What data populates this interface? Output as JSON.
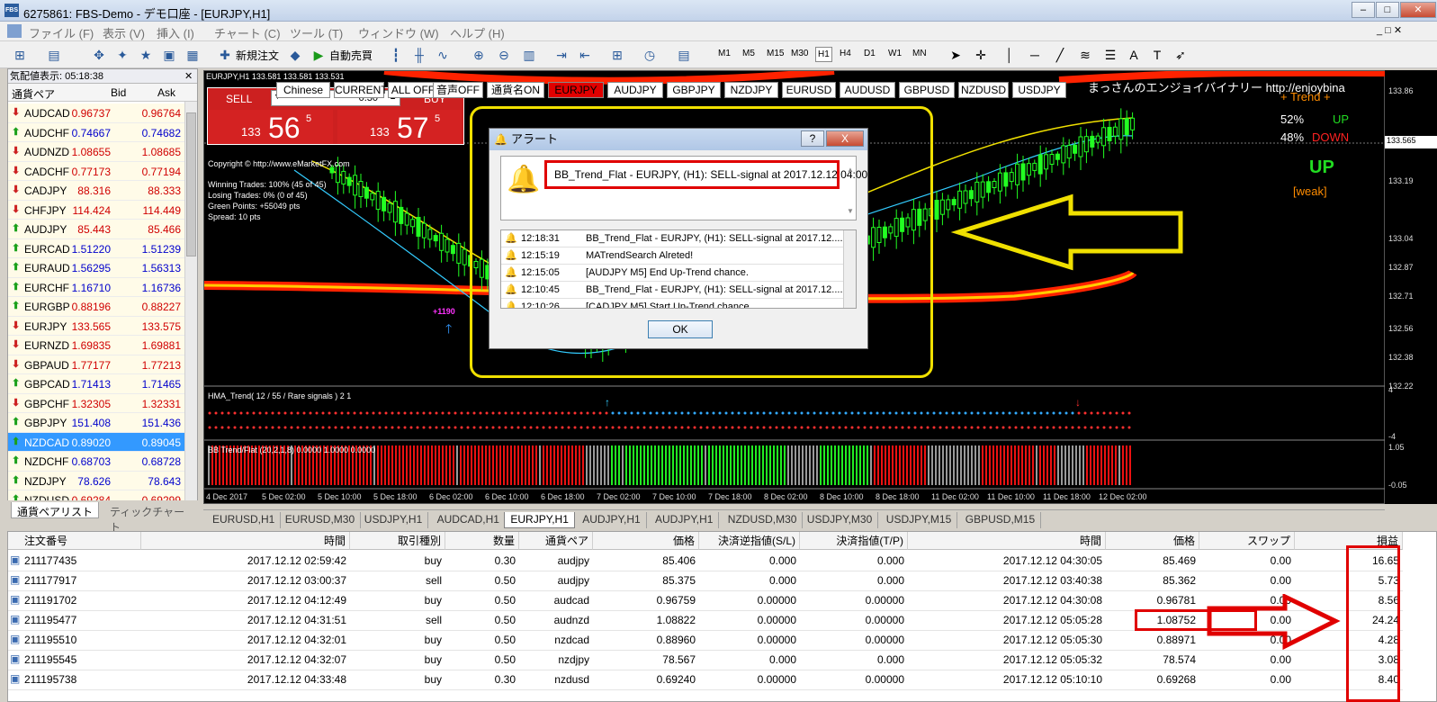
{
  "window": {
    "title": "6275861: FBS-Demo - デモ口座 - [EURJPY,H1]",
    "icon_text": "FBS"
  },
  "menu": [
    "ファイル (F)",
    "表示 (V)",
    "挿入 (I)",
    "チャート (C)",
    "ツール (T)",
    "ウィンドウ (W)",
    "ヘルプ (H)"
  ],
  "toolbar": {
    "new_order": "新規注文",
    "autotrade": "自動売買",
    "timeframes": [
      "M1",
      "M5",
      "M15",
      "M30",
      "H1",
      "H4",
      "D1",
      "W1",
      "MN"
    ],
    "selected_tf": "H1"
  },
  "market_watch": {
    "header": "気配値表示: 05:18:38",
    "columns": [
      "通貨ペア",
      "Bid",
      "Ask"
    ],
    "rows": [
      {
        "symbol": "AUDCAD",
        "bid": "0.96737",
        "ask": "0.96764",
        "dir": "dn"
      },
      {
        "symbol": "AUDCHF",
        "bid": "0.74667",
        "ask": "0.74682",
        "dir": "up"
      },
      {
        "symbol": "AUDNZD",
        "bid": "1.08655",
        "ask": "1.08685",
        "dir": "dn"
      },
      {
        "symbol": "CADCHF",
        "bid": "0.77173",
        "ask": "0.77194",
        "dir": "dn"
      },
      {
        "symbol": "CADJPY",
        "bid": "88.316",
        "ask": "88.333",
        "dir": "dn"
      },
      {
        "symbol": "CHFJPY",
        "bid": "114.424",
        "ask": "114.449",
        "dir": "dn"
      },
      {
        "symbol": "AUDJPY",
        "bid": "85.443",
        "ask": "85.466",
        "dir": "up"
      },
      {
        "symbol": "EURCAD",
        "bid": "1.51220",
        "ask": "1.51239",
        "dir": "up"
      },
      {
        "symbol": "EURAUD",
        "bid": "1.56295",
        "ask": "1.56313",
        "dir": "up"
      },
      {
        "symbol": "EURCHF",
        "bid": "1.16710",
        "ask": "1.16736",
        "dir": "up"
      },
      {
        "symbol": "EURGBP",
        "bid": "0.88196",
        "ask": "0.88227",
        "dir": "up"
      },
      {
        "symbol": "EURJPY",
        "bid": "133.565",
        "ask": "133.575",
        "dir": "dn"
      },
      {
        "symbol": "EURNZD",
        "bid": "1.69835",
        "ask": "1.69881",
        "dir": "dn"
      },
      {
        "symbol": "GBPAUD",
        "bid": "1.77177",
        "ask": "1.77213",
        "dir": "dn"
      },
      {
        "symbol": "GBPCAD",
        "bid": "1.71413",
        "ask": "1.71465",
        "dir": "up"
      },
      {
        "symbol": "GBPCHF",
        "bid": "1.32305",
        "ask": "1.32331",
        "dir": "dn"
      },
      {
        "symbol": "GBPJPY",
        "bid": "151.408",
        "ask": "151.436",
        "dir": "up"
      },
      {
        "symbol": "NZDCAD",
        "bid": "0.89020",
        "ask": "0.89045",
        "dir": "up"
      },
      {
        "symbol": "NZDCHF",
        "bid": "0.68703",
        "ask": "0.68728",
        "dir": "up"
      },
      {
        "symbol": "NZDJPY",
        "bid": "78.626",
        "ask": "78.643",
        "dir": "up"
      },
      {
        "symbol": "NZDUSD",
        "bid": "0.69284",
        "ask": "0.69299",
        "dir": "up"
      }
    ],
    "tabs": [
      "通貨ペアリスト",
      "ティックチャート"
    ]
  },
  "chart": {
    "header": "EURJPY,H1  133.581 133.581 133.531",
    "trade_panel": {
      "sell": "SELL",
      "buy": "BUY",
      "lot": "0.30",
      "sell_big": "56",
      "sell_small": "133",
      "sell_sup": "5",
      "buy_big": "57",
      "buy_small": "133",
      "buy_sup": "5"
    },
    "buttons": [
      {
        "label": "Chinese",
        "red": false
      },
      {
        "label": "CURRENT",
        "red": false
      },
      {
        "label": "ALL OFF",
        "red": false
      },
      {
        "label": "音声OFF",
        "red": false
      },
      {
        "label": "通貨名ON",
        "red": false
      },
      {
        "label": "EURJPY",
        "red": true
      },
      {
        "label": "AUDJPY",
        "red": false
      },
      {
        "label": "GBPJPY",
        "red": false
      },
      {
        "label": "NZDJPY",
        "red": false
      },
      {
        "label": "EURUSD",
        "red": false
      },
      {
        "label": "AUDUSD",
        "red": false
      },
      {
        "label": "GBPUSD",
        "red": false
      },
      {
        "label": "NZDUSD",
        "red": false
      },
      {
        "label": "USDJPY",
        "red": false
      }
    ],
    "copyright": "Copyright © http://www.eMarketFX.com",
    "stats": [
      "Winning Trades: 100% (45 of 45)",
      "Losing Trades: 0% (0 of 45)",
      "Green Points: +55049 pts",
      "Spread: 10 pts"
    ],
    "signal_label": "+1190",
    "banner": "まっさんのエンジョイバイナリー  http://enjoybina",
    "trend": {
      "title": "+ Trend +",
      "up_pct": "52%",
      "up_lbl": "UP",
      "down_pct": "48%",
      "down_lbl": "DOWN",
      "signal": "UP",
      "strength": "[weak]"
    },
    "price_axis": [
      "133.86",
      "133.56",
      "133.19",
      "133.04",
      "132.87",
      "132.71",
      "132.56",
      "132.38",
      "132.22"
    ],
    "price_current": "133.565",
    "ind1_label": "HMA_Trend( 12 / 55 / Rare signals ) 2 1",
    "ind1_axis": [
      "4",
      "-4"
    ],
    "ind2_label": "BB Trend/Flat (20,2,1,8) 0.0000 1.0000 0.0000",
    "ind2_axis": [
      "1.05",
      "-0.05"
    ],
    "time_axis": [
      "4 Dec 2017",
      "5 Dec 02:00",
      "5 Dec 10:00",
      "5 Dec 18:00",
      "6 Dec 02:00",
      "6 Dec 10:00",
      "6 Dec 18:00",
      "7 Dec 02:00",
      "7 Dec 10:00",
      "7 Dec 18:00",
      "8 Dec 02:00",
      "8 Dec 10:00",
      "8 Dec 18:00",
      "11 Dec 02:00",
      "11 Dec 10:00",
      "11 Dec 18:00",
      "12 Dec 02:00"
    ]
  },
  "chart_tabs": [
    "EURUSD,H1",
    "EURUSD,M30",
    "USDJPY,H1",
    "AUDCAD,H1",
    "EURJPY,H1",
    "AUDJPY,H1",
    "AUDJPY,H1",
    "NZDUSD,M30",
    "USDJPY,M30",
    "USDJPY,M15",
    "GBPUSD,M15"
  ],
  "active_chart_tab": "EURJPY,H1",
  "dialog": {
    "title": "アラート",
    "main": "BB_Trend_Flat - EURJPY, (H1): SELL-signal at 2017.12.12 04:00",
    "rows": [
      {
        "time": "12:18:31",
        "msg": "BB_Trend_Flat - EURJPY, (H1): SELL-signal at 2017.12...."
      },
      {
        "time": "12:15:19",
        "msg": "MATrendSearch Alreted!"
      },
      {
        "time": "12:15:05",
        "msg": "[AUDJPY M5] End Up-Trend chance."
      },
      {
        "time": "12:10:45",
        "msg": "BB_Trend_Flat - EURJPY, (H1): SELL-signal at 2017.12...."
      },
      {
        "time": "12:10:26",
        "msg": "[CADJPY M5] Start Up-Trend chance."
      }
    ],
    "ok": "OK",
    "help": "?",
    "close": "X"
  },
  "orders": {
    "columns": [
      "注文番号",
      "時間",
      "取引種別",
      "数量",
      "通貨ペア",
      "価格",
      "決済逆指値(S/L)",
      "決済指値(T/P)",
      "時間",
      "価格",
      "スワップ",
      "損益"
    ],
    "rows": [
      [
        "211177435",
        "2017.12.12 02:59:42",
        "buy",
        "0.30",
        "audjpy",
        "85.406",
        "0.000",
        "0.000",
        "2017.12.12 04:30:05",
        "85.469",
        "0.00",
        "16.65"
      ],
      [
        "211177917",
        "2017.12.12 03:00:37",
        "sell",
        "0.50",
        "audjpy",
        "85.375",
        "0.000",
        "0.000",
        "2017.12.12 03:40:38",
        "85.362",
        "0.00",
        "5.73"
      ],
      [
        "211191702",
        "2017.12.12 04:12:49",
        "buy",
        "0.50",
        "audcad",
        "0.96759",
        "0.00000",
        "0.00000",
        "2017.12.12 04:30:08",
        "0.96781",
        "0.00",
        "8.56"
      ],
      [
        "211195477",
        "2017.12.12 04:31:51",
        "sell",
        "0.50",
        "audnzd",
        "1.08822",
        "0.00000",
        "0.00000",
        "2017.12.12 05:05:28",
        "1.08752",
        "0.00",
        "24.24"
      ],
      [
        "211195510",
        "2017.12.12 04:32:01",
        "buy",
        "0.50",
        "nzdcad",
        "0.88960",
        "0.00000",
        "0.00000",
        "2017.12.12 05:05:30",
        "0.88971",
        "0.00",
        "4.28"
      ],
      [
        "211195545",
        "2017.12.12 04:32:07",
        "buy",
        "0.50",
        "nzdjpy",
        "78.567",
        "0.000",
        "0.000",
        "2017.12.12 05:05:32",
        "78.574",
        "0.00",
        "3.08"
      ],
      [
        "211195738",
        "2017.12.12 04:33:48",
        "buy",
        "0.30",
        "nzdusd",
        "0.69240",
        "0.00000",
        "0.00000",
        "2017.12.12 05:10:10",
        "0.69268",
        "0.00",
        "8.40"
      ]
    ]
  }
}
